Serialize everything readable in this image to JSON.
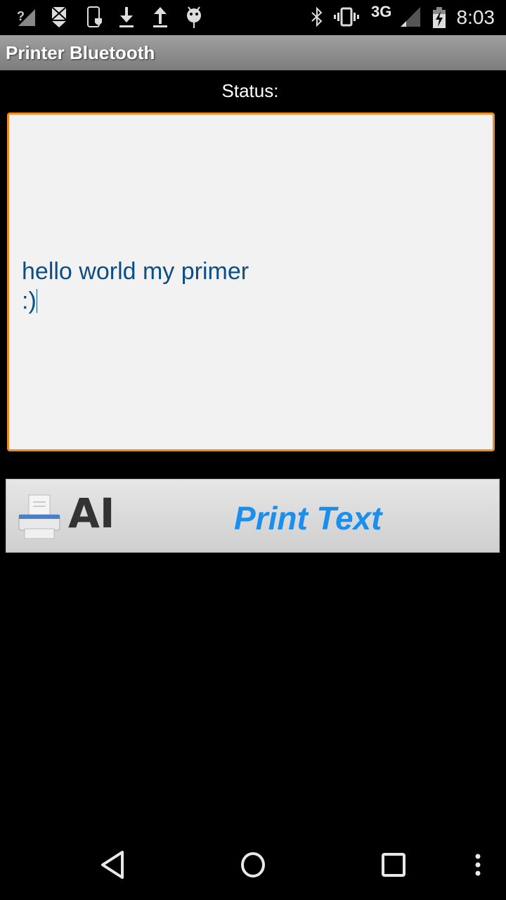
{
  "status_bar": {
    "left_icons": [
      "signal-unknown-icon",
      "download-pending-icon",
      "phone-shield-icon",
      "download-icon",
      "upload-icon",
      "android-debug-icon"
    ],
    "right_icons": [
      "bluetooth-icon",
      "vibrate-icon",
      "network-3g-icon",
      "cell-signal-icon",
      "battery-charging-icon"
    ],
    "network": "3G",
    "time": "8:03"
  },
  "app": {
    "title": "Printer Bluetooth"
  },
  "main": {
    "status_label": "Status:",
    "text_area_value": "hello world my primer\n:)",
    "print_button_label": "Print Text",
    "print_button_icon_text": "AI"
  },
  "colors": {
    "accent_border": "#f28c1f",
    "text_color": "#0d4f85",
    "button_text": "#1a8ff0"
  },
  "nav_bar": {
    "buttons": [
      "back",
      "home",
      "recents",
      "menu"
    ]
  }
}
